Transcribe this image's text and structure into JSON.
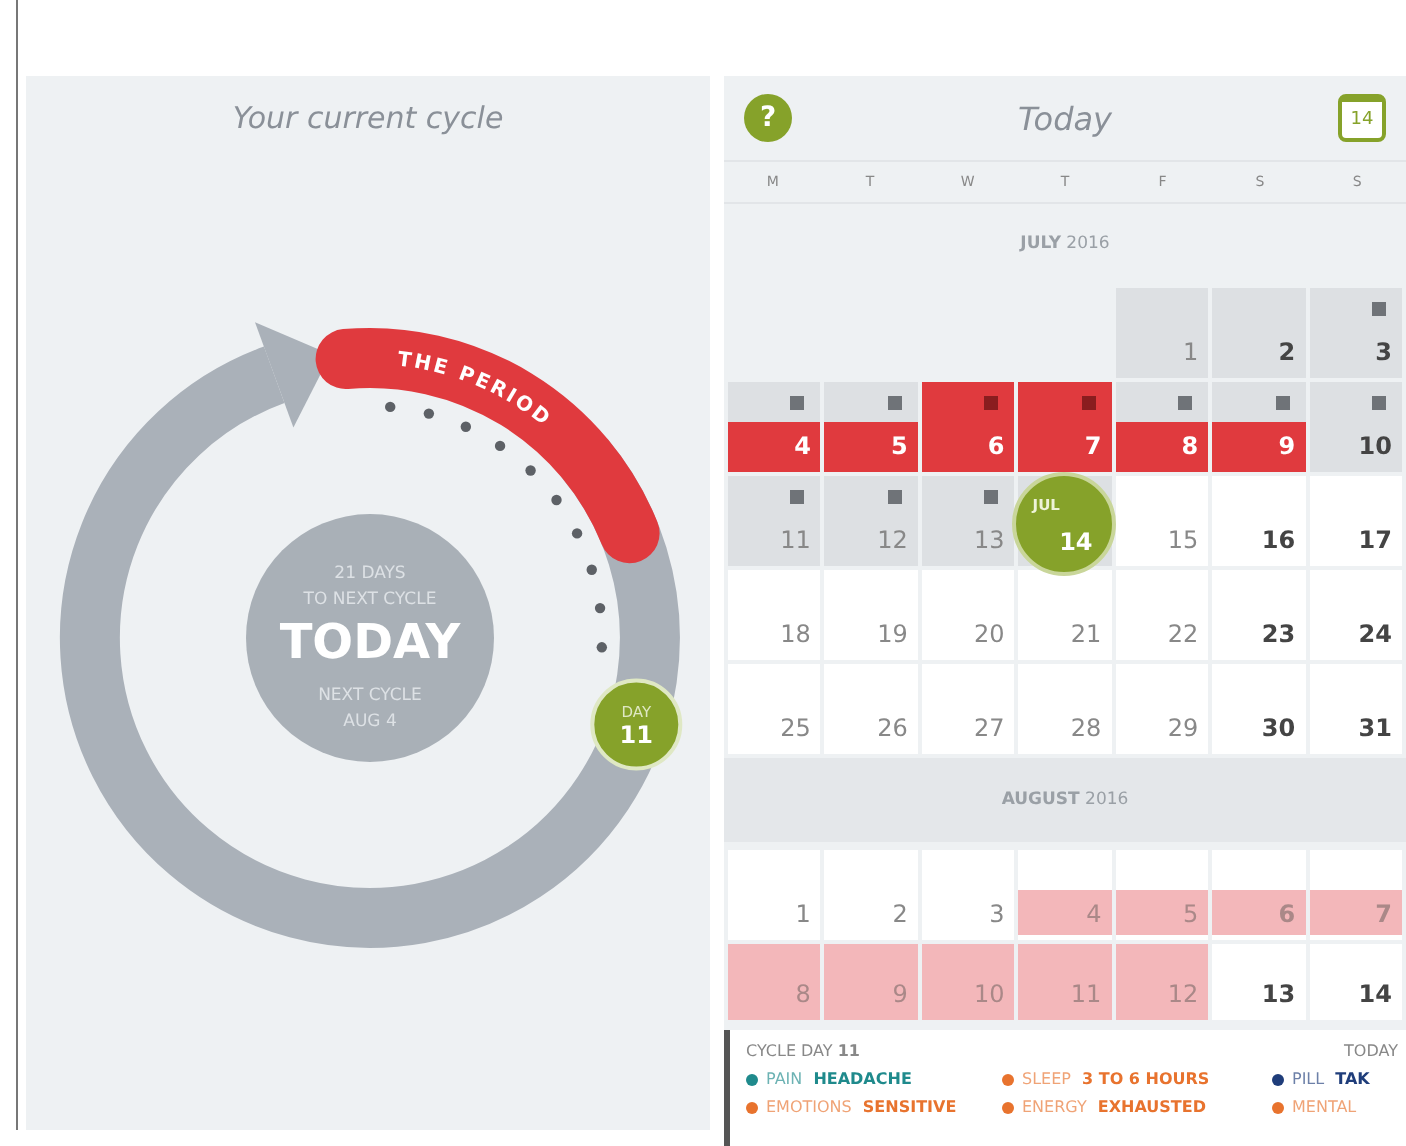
{
  "cycle_panel": {
    "title": "Your current cycle",
    "period_label": "THE PERIOD",
    "center": {
      "days_left": "21 DAYS",
      "days_left_caption": "TO NEXT CYCLE",
      "headline": "TODAY",
      "next_caption": "NEXT CYCLE",
      "next_date": "AUG 4"
    },
    "day_badge": {
      "label": "DAY",
      "day": "11"
    }
  },
  "calendar": {
    "help": "?",
    "title": "Today",
    "today_button": "14",
    "weekdays": [
      "M",
      "T",
      "W",
      "T",
      "F",
      "S",
      "S"
    ],
    "months": [
      {
        "label": "**JULY** 2016",
        "days": [
          {
            "kind": "blank"
          },
          {
            "kind": "blank"
          },
          {
            "kind": "blank"
          },
          {
            "kind": "blank"
          },
          {
            "day": "1",
            "kind": "past",
            "dot": false
          },
          {
            "day": "2",
            "kind": "past",
            "dot": false
          },
          {
            "day": "3",
            "kind": "past",
            "dot": true
          },
          {
            "day": "4",
            "kind": "period-half",
            "dot": true
          },
          {
            "day": "5",
            "kind": "period-half",
            "dot": true
          },
          {
            "day": "6",
            "kind": "period",
            "dot": true
          },
          {
            "day": "7",
            "kind": "period",
            "dot": true
          },
          {
            "day": "8",
            "kind": "period-half",
            "dot": true
          },
          {
            "day": "9",
            "kind": "period-half",
            "dot": true
          },
          {
            "day": "10",
            "kind": "past",
            "dot": true
          },
          {
            "day": "11",
            "kind": "past",
            "dot": true
          },
          {
            "day": "12",
            "kind": "past",
            "dot": true
          },
          {
            "day": "13",
            "kind": "past",
            "dot": true
          },
          {
            "day": "14",
            "kind": "today",
            "month": "JUL"
          },
          {
            "day": "15",
            "kind": "future",
            "dot": false
          },
          {
            "day": "16",
            "kind": "future",
            "dot": false
          },
          {
            "day": "17",
            "kind": "future",
            "dot": false
          },
          {
            "day": "18",
            "kind": "future",
            "dot": false
          },
          {
            "day": "19",
            "kind": "future",
            "dot": false
          },
          {
            "day": "20",
            "kind": "future",
            "dot": false
          },
          {
            "day": "21",
            "kind": "future",
            "dot": false
          },
          {
            "day": "22",
            "kind": "future",
            "dot": false
          },
          {
            "day": "23",
            "kind": "future",
            "dot": false
          },
          {
            "day": "24",
            "kind": "future",
            "dot": false
          },
          {
            "day": "25",
            "kind": "future",
            "dot": false
          },
          {
            "day": "26",
            "kind": "future",
            "dot": false
          },
          {
            "day": "27",
            "kind": "future",
            "dot": false
          },
          {
            "day": "28",
            "kind": "future",
            "dot": false
          },
          {
            "day": "29",
            "kind": "future",
            "dot": false
          },
          {
            "day": "30",
            "kind": "future",
            "dot": false
          },
          {
            "day": "31",
            "kind": "future",
            "dot": false
          }
        ]
      },
      {
        "label": "**AUGUST** 2016",
        "days": [
          {
            "day": "1",
            "kind": "future",
            "dot": false
          },
          {
            "day": "2",
            "kind": "future",
            "dot": false
          },
          {
            "day": "3",
            "kind": "future",
            "dot": false
          },
          {
            "day": "4",
            "kind": "predicted",
            "dot": false
          },
          {
            "day": "5",
            "kind": "predicted",
            "dot": false
          },
          {
            "day": "6",
            "kind": "predicted",
            "dot": false
          },
          {
            "day": "7",
            "kind": "predicted",
            "dot": false
          },
          {
            "day": "8",
            "kind": "predicted-top",
            "dot": false
          },
          {
            "day": "9",
            "kind": "predicted-top",
            "dot": false
          },
          {
            "day": "10",
            "kind": "predicted-top",
            "dot": false
          },
          {
            "day": "11",
            "kind": "predicted-top",
            "dot": false
          },
          {
            "day": "12",
            "kind": "predicted-top",
            "dot": false
          },
          {
            "day": "13",
            "kind": "future",
            "dot": false
          },
          {
            "day": "14",
            "kind": "future",
            "dot": false
          }
        ]
      }
    ]
  },
  "summary": {
    "cycle_day": "CYCLE DAY **11**",
    "date": "TODAY",
    "entries": [
      {
        "label": "PAIN",
        "value": "HEADACHE",
        "color": "#1f8a8c"
      },
      {
        "label": "SLEEP",
        "value": "3 TO 6 HOURS",
        "color": "#e8732e"
      },
      {
        "label": "PILL",
        "value": "TAK",
        "color": "#1f3d7a"
      },
      {
        "label": "EMOTIONS",
        "value": "SENSITIVE",
        "color": "#e8732e"
      },
      {
        "label": "ENERGY",
        "value": "EXHAUSTED",
        "color": "#e8732e"
      },
      {
        "label": "MENTAL",
        "color": "#e8732e"
      }
    ]
  }
}
